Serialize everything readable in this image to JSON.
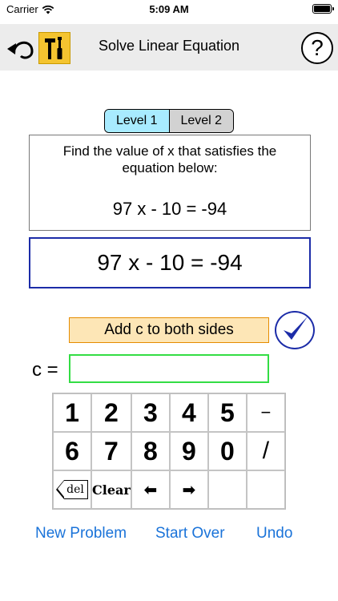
{
  "status_bar": {
    "carrier": "Carrier",
    "time": "5:09 AM"
  },
  "nav": {
    "title": "Solve Linear Equation",
    "help_label": "?"
  },
  "levels": [
    {
      "label": "Level 1",
      "selected": true
    },
    {
      "label": "Level 2",
      "selected": false
    }
  ],
  "problem": {
    "prompt": "Find the value of x that satisfies the equation below:",
    "equation": "97 x - 10 = -94"
  },
  "work": {
    "equation": "97 x - 10 = -94"
  },
  "action": {
    "label": "Add c to both sides"
  },
  "c_field": {
    "label": "c =",
    "value": ""
  },
  "keypad": {
    "row1": [
      "1",
      "2",
      "3",
      "4",
      "5",
      "−"
    ],
    "row2": [
      "6",
      "7",
      "8",
      "9",
      "0",
      "/"
    ],
    "del_label": "del",
    "clear_label": "Clear",
    "left_arrow": "⬅",
    "right_arrow": "➡"
  },
  "links": {
    "new_problem": "New Problem",
    "start_over": "Start Over",
    "undo": "Undo"
  },
  "colors": {
    "link": "#1a73d9",
    "level_active": "#a8ebff",
    "level_inactive": "#d2d2d2",
    "action_fill": "#fde6b6",
    "action_border": "#e58c00",
    "work_border": "#1c2ca8",
    "input_border": "#33dd44",
    "tools_fill": "#f4c430"
  }
}
